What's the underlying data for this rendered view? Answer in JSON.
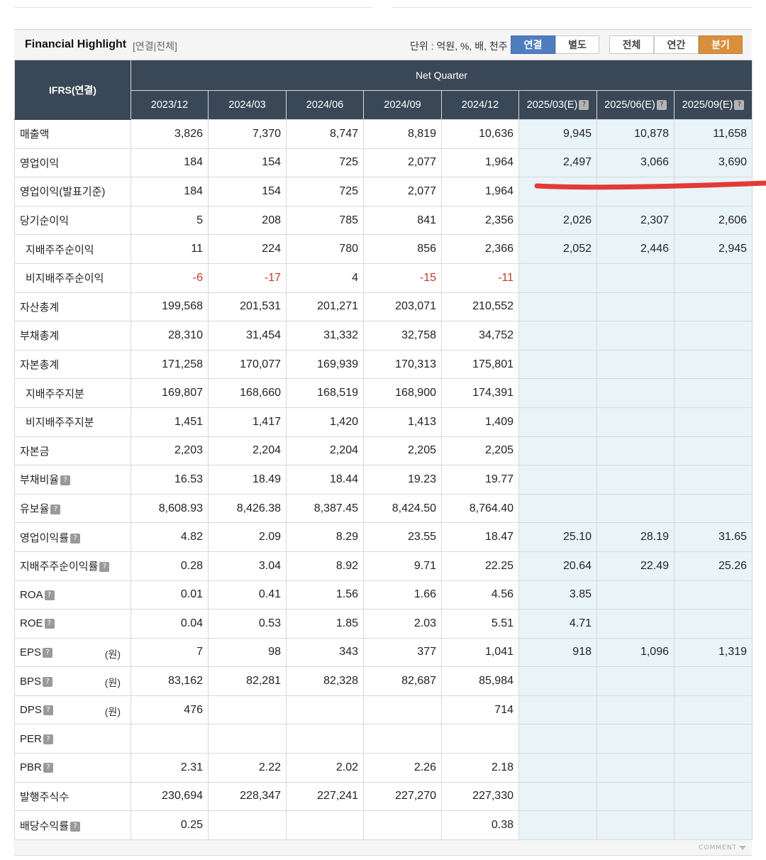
{
  "header": {
    "title": "Financial Highlight",
    "subtitle": "[연결|전체]",
    "unit": "단위 : 억원, %, 배, 천주",
    "btn_consolidated": "연결",
    "btn_separate": "별도",
    "btn_all": "전체",
    "btn_annual": "연간",
    "btn_quarter": "분기"
  },
  "table": {
    "corner_label": "IFRS(연결)",
    "group_label": "Net Quarter",
    "periods": [
      "2023/12",
      "2024/03",
      "2024/06",
      "2024/09",
      "2024/12",
      "2025/03(E)",
      "2025/06(E)",
      "2025/09(E)"
    ],
    "help_glyph": "?",
    "won_unit": "(원)",
    "rows": [
      {
        "label": "매출액",
        "values": [
          "3,826",
          "7,370",
          "8,747",
          "8,819",
          "10,636",
          "9,945",
          "10,878",
          "11,658"
        ]
      },
      {
        "label": "영업이익",
        "values": [
          "184",
          "154",
          "725",
          "2,077",
          "1,964",
          "2,497",
          "3,066",
          "3,690"
        ]
      },
      {
        "label": "영업이익(발표기준)",
        "values": [
          "184",
          "154",
          "725",
          "2,077",
          "1,964",
          "",
          "",
          ""
        ]
      },
      {
        "label": "당기순이익",
        "values": [
          "5",
          "208",
          "785",
          "841",
          "2,356",
          "2,026",
          "2,307",
          "2,606"
        ]
      },
      {
        "label": "지배주주순이익",
        "values": [
          "11",
          "224",
          "780",
          "856",
          "2,366",
          "2,052",
          "2,446",
          "2,945"
        ]
      },
      {
        "label": "비지배주주순이익",
        "values": [
          "-6",
          "-17",
          "4",
          "-15",
          "-11",
          "",
          "",
          ""
        ]
      },
      {
        "label": "자산총계",
        "values": [
          "199,568",
          "201,531",
          "201,271",
          "203,071",
          "210,552",
          "",
          "",
          ""
        ]
      },
      {
        "label": "부채총계",
        "values": [
          "28,310",
          "31,454",
          "31,332",
          "32,758",
          "34,752",
          "",
          "",
          ""
        ]
      },
      {
        "label": "자본총계",
        "values": [
          "171,258",
          "170,077",
          "169,939",
          "170,313",
          "175,801",
          "",
          "",
          ""
        ]
      },
      {
        "label": "지배주주지분",
        "values": [
          "169,807",
          "168,660",
          "168,519",
          "168,900",
          "174,391",
          "",
          "",
          ""
        ]
      },
      {
        "label": "비지배주주지분",
        "values": [
          "1,451",
          "1,417",
          "1,420",
          "1,413",
          "1,409",
          "",
          "",
          ""
        ]
      },
      {
        "label": "자본금",
        "values": [
          "2,203",
          "2,204",
          "2,204",
          "2,205",
          "2,205",
          "",
          "",
          ""
        ]
      },
      {
        "label": "부채비율",
        "values": [
          "16.53",
          "18.49",
          "18.44",
          "19.23",
          "19.77",
          "",
          "",
          ""
        ]
      },
      {
        "label": "유보율",
        "values": [
          "8,608.93",
          "8,426.38",
          "8,387.45",
          "8,424.50",
          "8,764.40",
          "",
          "",
          ""
        ]
      },
      {
        "label": "영업이익률",
        "values": [
          "4.82",
          "2.09",
          "8.29",
          "23.55",
          "18.47",
          "25.10",
          "28.19",
          "31.65"
        ]
      },
      {
        "label": "지배주주순이익률",
        "values": [
          "0.28",
          "3.04",
          "8.92",
          "9.71",
          "22.25",
          "20.64",
          "22.49",
          "25.26"
        ]
      },
      {
        "label": "ROA",
        "values": [
          "0.01",
          "0.41",
          "1.56",
          "1.66",
          "4.56",
          "3.85",
          "",
          ""
        ]
      },
      {
        "label": "ROE",
        "values": [
          "0.04",
          "0.53",
          "1.85",
          "2.03",
          "5.51",
          "4.71",
          "",
          ""
        ]
      },
      {
        "label": "EPS",
        "values": [
          "7",
          "98",
          "343",
          "377",
          "1,041",
          "918",
          "1,096",
          "1,319"
        ]
      },
      {
        "label": "BPS",
        "values": [
          "83,162",
          "82,281",
          "82,328",
          "82,687",
          "85,984",
          "",
          "",
          ""
        ]
      },
      {
        "label": "DPS",
        "values": [
          "476",
          "",
          "",
          "",
          "714",
          "",
          "",
          ""
        ]
      },
      {
        "label": "PER",
        "values": [
          "",
          "",
          "",
          "",
          "",
          "",
          "",
          ""
        ]
      },
      {
        "label": "PBR",
        "values": [
          "2.31",
          "2.22",
          "2.02",
          "2.26",
          "2.18",
          "",
          "",
          ""
        ]
      },
      {
        "label": "발행주식수",
        "values": [
          "230,694",
          "228,347",
          "227,241",
          "227,270",
          "227,330",
          "",
          "",
          ""
        ]
      },
      {
        "label": "배당수익률",
        "values": [
          "0.25",
          "",
          "",
          "",
          "0.38",
          "",
          "",
          ""
        ]
      }
    ]
  },
  "footer": {
    "comment": "COMMENT"
  },
  "colors": {
    "header_bg": "#3a4756",
    "estimate_bg": "#e9f4f8",
    "negative": "#c23a2e",
    "btn_blue": "#4f7ec0",
    "btn_orange": "#d88f3e",
    "annotation_stroke": "#e53935"
  }
}
